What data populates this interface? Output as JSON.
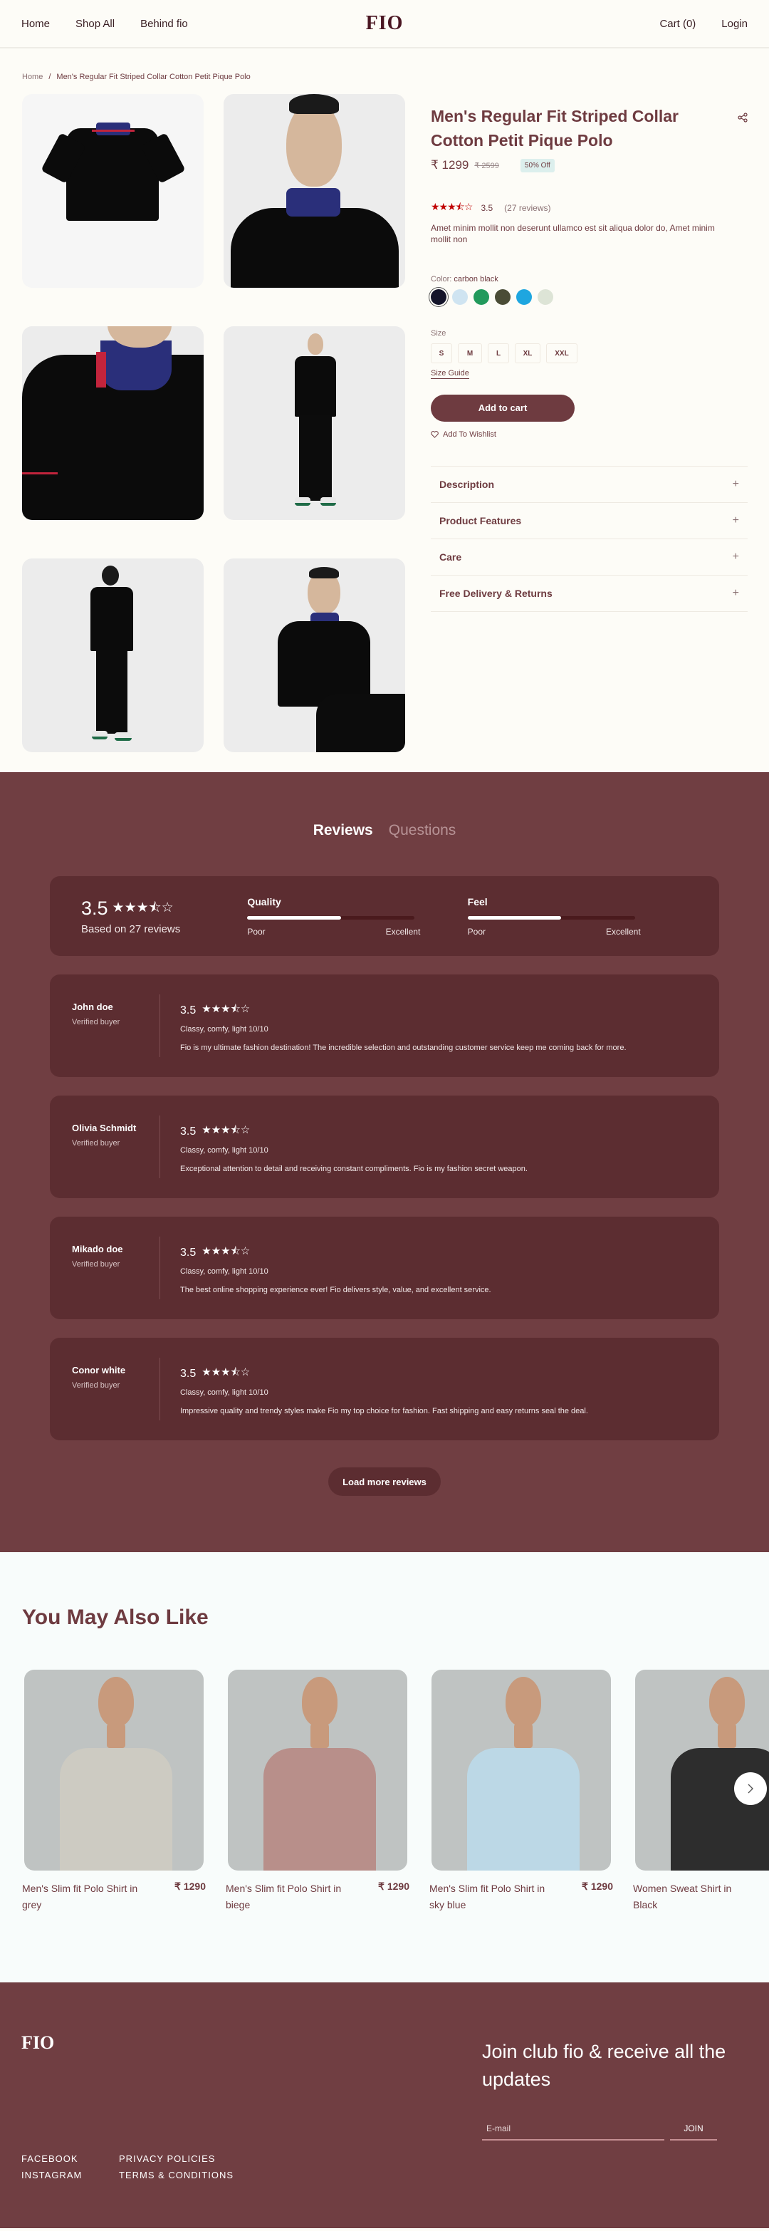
{
  "header": {
    "nav_left": [
      "Home",
      "Shop All",
      "Behind fio"
    ],
    "logo": "FIO",
    "nav_right": [
      "Cart (0)",
      "Login"
    ]
  },
  "breadcrumb": {
    "home": "Home",
    "separator": "/",
    "current": "Men's Regular Fit Striped Collar Cotton Petit Pique Polo"
  },
  "product": {
    "title": "Men's Regular Fit Striped Collar Cotton Petit Pique Polo",
    "price": "₹ 1299",
    "old_price": "₹ 2599",
    "discount": "50% Off",
    "rating": "3.5",
    "rating_stars": "★★★⯪☆",
    "reviews_count": "(27 reviews)",
    "description": "Amet minim mollit non deserunt ullamco est sit aliqua dolor do, Amet minim mollit non",
    "color_label": "Color:",
    "color_value": "carbon black",
    "colors": [
      {
        "name": "carbon black",
        "hex": "#14142a",
        "selected": true
      },
      {
        "name": "light blue",
        "hex": "#cfe4f1",
        "selected": false
      },
      {
        "name": "green",
        "hex": "#229a5c",
        "selected": false
      },
      {
        "name": "olive",
        "hex": "#4a4c36",
        "selected": false
      },
      {
        "name": "sky blue",
        "hex": "#1ea6e0",
        "selected": false
      },
      {
        "name": "sage",
        "hex": "#dde4d6",
        "selected": false
      }
    ],
    "size_label": "Size",
    "sizes": [
      "S",
      "M",
      "L",
      "XL",
      "XXL"
    ],
    "size_guide": "Size Guide",
    "add_to_cart": "Add to cart",
    "wishlist": "Add To Wishlist",
    "accordion": [
      "Description",
      "Product Features",
      "Care",
      "Free Delivery & Returns"
    ],
    "gallery_alts": [
      "Polo flat lay",
      "Model front close-up",
      "Collar detail",
      "Full body front",
      "Full body back",
      "Model seated"
    ]
  },
  "reviews": {
    "tabs": [
      "Reviews",
      "Questions"
    ],
    "summary": {
      "score": "3.5",
      "stars": "★★★⯪☆",
      "based_on": "Based on 27 reviews",
      "metrics": [
        {
          "title": "Quality",
          "low": "Poor",
          "high": "Excellent",
          "fraction": 0.56
        },
        {
          "title": "Feel",
          "low": "Poor",
          "high": "Excellent",
          "fraction": 0.56
        }
      ]
    },
    "items": [
      {
        "name": "John doe",
        "verified": "Verified buyer",
        "score": "3.5",
        "stars": "★★★⯪☆",
        "tag": "Classy, comfy, light 10/10",
        "text": "Fio is my ultimate fashion destination! The incredible selection and outstanding customer service keep me coming back for more."
      },
      {
        "name": "Olivia Schmidt",
        "verified": "Verified buyer",
        "score": "3.5",
        "stars": "★★★⯪☆",
        "tag": "Classy, comfy, light 10/10",
        "text": "Exceptional attention to detail and receiving constant compliments. Fio is my fashion secret weapon."
      },
      {
        "name": "Mikado doe",
        "verified": "Verified buyer",
        "score": "3.5",
        "stars": "★★★⯪☆",
        "tag": "Classy, comfy, light 10/10",
        "text": "The best online shopping experience ever! Fio delivers style, value, and excellent service."
      },
      {
        "name": "Conor white",
        "verified": "Verified buyer",
        "score": "3.5",
        "stars": "★★★⯪☆",
        "tag": "Classy, comfy, light 10/10",
        "text": "Impressive quality and trendy styles make Fio my top choice for fashion. Fast shipping and easy returns seal the deal."
      }
    ],
    "load_more": "Load more reviews"
  },
  "recommend": {
    "title": "You May Also Like",
    "items": [
      {
        "name": "Men's Slim fit Polo Shirt in grey",
        "price": "₹ 1290",
        "shirt": "#cdcbc2"
      },
      {
        "name": "Men's Slim fit Polo Shirt in biege",
        "price": "₹ 1290",
        "shirt": "#b88f8a"
      },
      {
        "name": "Men's Slim fit Polo Shirt in sky blue",
        "price": "₹ 1290",
        "shirt": "#bcd8e6"
      },
      {
        "name": "Women Sweat Shirt in Black",
        "price": "",
        "shirt": "#2d2d2d"
      }
    ]
  },
  "footer": {
    "logo": "FIO",
    "join_title": "Join club fio & receive all the updates",
    "email_placeholder": "E-mail",
    "join_button": "JOIN",
    "links": [
      "FACEBOOK",
      "PRIVACY POLICIES",
      "INSTAGRAM",
      "TERMS & CONDITIONS"
    ]
  },
  "colors": {
    "brand": "#6e3b40",
    "brand_dark": "#5c2d31",
    "background": "#fdfcf7",
    "star_red": "#c00000",
    "badge_bg": "#dcefed"
  }
}
